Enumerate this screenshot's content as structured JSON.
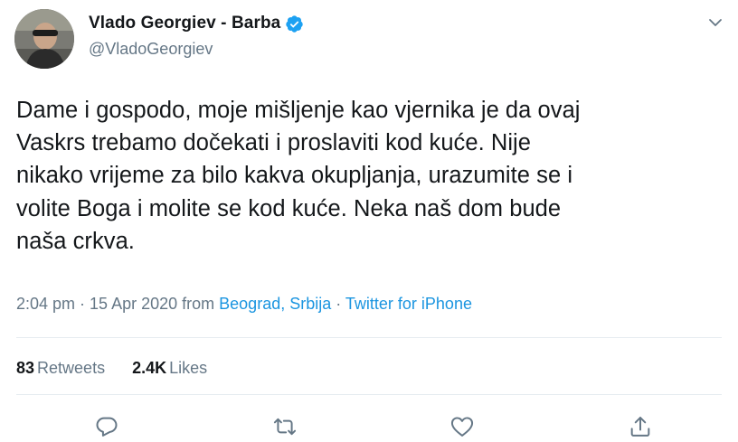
{
  "tweet": {
    "author": {
      "display_name": "Vlado Georgiev - Barba",
      "handle": "@VladoGeorgiev",
      "verified": true,
      "avatar": "profile-photo"
    },
    "text_lines": [
      "Dame i gospodo, moje mišljenje kao vjernika je da ovaj",
      "Vaskrs trebamo dočekati i proslaviti kod kuće. Nije",
      "nikako vrijeme za bilo kakva okupljanja, urazumite se i",
      "volite Boga i molite se kod kuće. Neka naš dom bude",
      "naša crkva."
    ],
    "meta": {
      "time": "2:04 pm",
      "sep1": " · ",
      "date": "15 Apr 2020",
      "from": " from ",
      "location": "Beograd, Srbija",
      "sep2": " · ",
      "source": "Twitter for iPhone"
    },
    "stats": {
      "retweets_count": "83",
      "retweets_label": "Retweets",
      "likes_count": "2.4K",
      "likes_label": "Likes"
    },
    "actions": [
      {
        "name": "reply",
        "icon": "reply-icon"
      },
      {
        "name": "retweet",
        "icon": "retweet-icon"
      },
      {
        "name": "like",
        "icon": "heart-icon"
      },
      {
        "name": "share",
        "icon": "share-icon"
      }
    ]
  },
  "colors": {
    "text": "#14171a",
    "secondary": "#657786",
    "link": "#1b95e0",
    "verified": "#1da1f2",
    "divider": "#e6ecf0"
  }
}
